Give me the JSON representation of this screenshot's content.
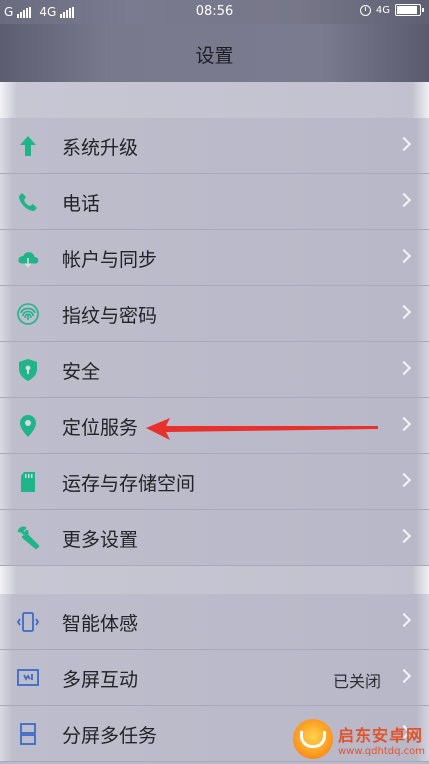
{
  "status_bar": {
    "carrier1": "G",
    "carrier2": "4G",
    "time": "08:56",
    "network": "4G"
  },
  "header": {
    "title": "设置"
  },
  "groups": [
    {
      "items": [
        {
          "label": "系统升级",
          "icon": "arrow-up-icon",
          "value": ""
        },
        {
          "label": "电话",
          "icon": "phone-icon",
          "value": ""
        },
        {
          "label": "帐户与同步",
          "icon": "cloud-sync-icon",
          "value": ""
        },
        {
          "label": "指纹与密码",
          "icon": "fingerprint-icon",
          "value": ""
        },
        {
          "label": "安全",
          "icon": "shield-icon",
          "value": ""
        },
        {
          "label": "定位服务",
          "icon": "location-pin-icon",
          "value": ""
        },
        {
          "label": "运存与存储空间",
          "icon": "sd-card-icon",
          "value": ""
        },
        {
          "label": "更多设置",
          "icon": "wrench-icon",
          "value": ""
        }
      ]
    },
    {
      "items": [
        {
          "label": "智能体感",
          "icon": "motion-phone-icon",
          "value": ""
        },
        {
          "label": "多屏互动",
          "icon": "cast-screen-icon",
          "value": "已关闭"
        },
        {
          "label": "分屏多任务",
          "icon": "split-screen-icon",
          "value": ""
        }
      ]
    }
  ],
  "watermark": {
    "name": "启东安卓网",
    "url": "www.qdhtdq.com"
  },
  "colors": {
    "accent_green": "#1fb48a",
    "accent_blue": "#3b6bc9",
    "annotation_red": "#e8302c"
  }
}
